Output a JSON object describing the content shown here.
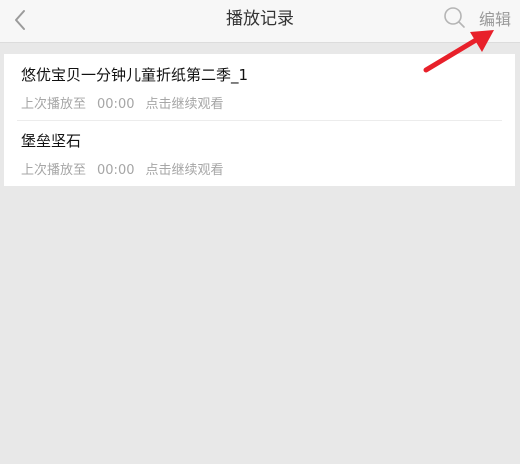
{
  "header": {
    "title": "播放记录",
    "edit_label": "编辑",
    "back_icon": "back-chevron-icon",
    "search_icon": "search-icon"
  },
  "history": [
    {
      "title": "悠优宝贝一分钟儿童折纸第二季_1",
      "played_prefix": "上次播放至",
      "played_time": "00:00",
      "continue_label": "点击继续观看"
    },
    {
      "title": "堡垒坚石",
      "played_prefix": "上次播放至",
      "played_time": "00:00",
      "continue_label": "点击继续观看"
    }
  ],
  "annotation": {
    "arrow_color": "#e8202a"
  }
}
